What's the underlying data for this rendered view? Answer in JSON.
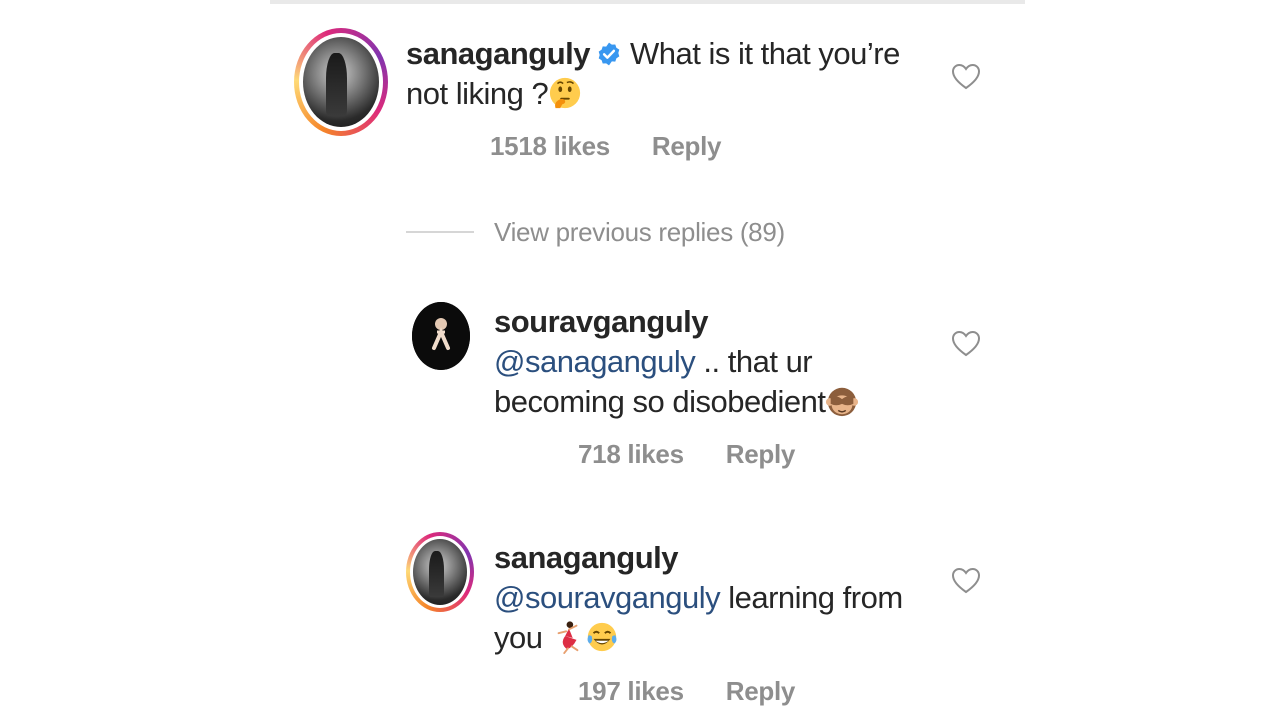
{
  "comments": [
    {
      "username": "sanaganguly",
      "verified": true,
      "text": "What is it that you’re not liking ?",
      "emoji": [
        "thinking-face"
      ],
      "likes": "1518 likes",
      "reply": "Reply"
    }
  ],
  "thread": {
    "view_previous": "View previous replies (89)"
  },
  "replies": [
    {
      "username": "souravganguly",
      "mention": "@sanaganguly",
      "text": " .. that ur becoming so disobedient",
      "emoji": [
        "see-no-evil-monkey"
      ],
      "likes": "718 likes",
      "reply": "Reply"
    },
    {
      "username": "sanaganguly",
      "mention": "@souravganguly",
      "text": " learning from you ",
      "emoji": [
        "dancer",
        "tears-of-joy"
      ],
      "likes": "197 likes",
      "reply": "Reply"
    }
  ],
  "colors": {
    "mention": "#2b4f7e",
    "verified_badge": "#3897f0",
    "meta_gray": "#8e8e8e"
  }
}
